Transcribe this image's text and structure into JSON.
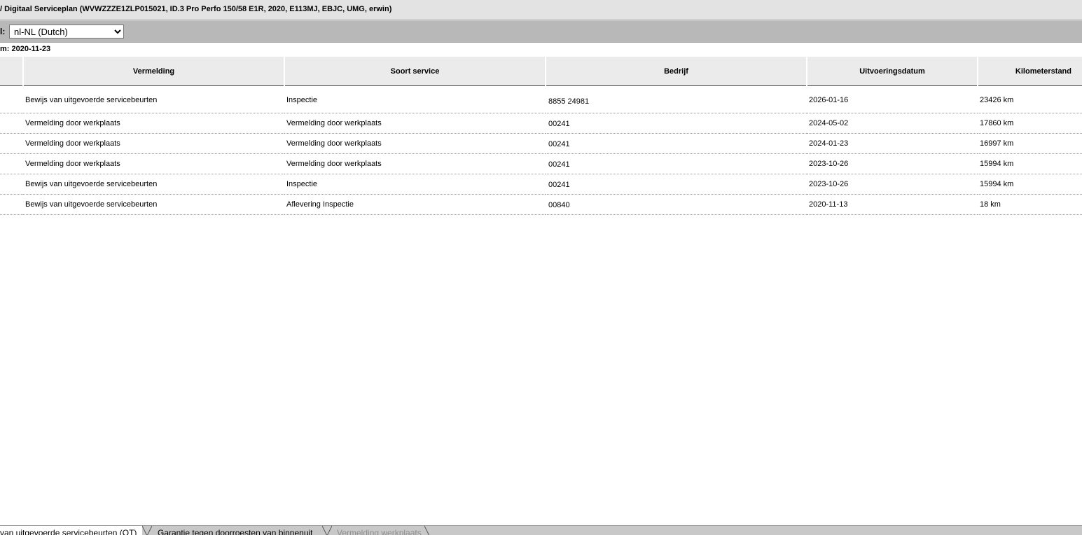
{
  "window": {
    "title": "/ Digitaal Serviceplan (WVWZZZE1ZLP015021, ID.3 Pro Perfo 150/58 E1R, 2020, E113MJ, EBJC, UMG, erwin)"
  },
  "language": {
    "label": "l:",
    "selected": "nl-NL (Dutch)"
  },
  "date_line": "m: 2020-11-23",
  "table": {
    "headers": {
      "col0": "",
      "vermelding": "Vermelding",
      "soort_service": "Soort service",
      "bedrijf": "Bedrijf",
      "uitvoeringsdatum": "Uitvoeringsdatum",
      "kilometerstand": "Kilometerstand"
    },
    "rows": [
      {
        "vermelding": "Bewijs van uitgevoerde servicebeurten",
        "soort_service": "Inspectie",
        "bedrijf": "8855 24981",
        "datum": "2026-01-16",
        "km": "23426 km"
      },
      {
        "vermelding": "Vermelding door werkplaats",
        "soort_service": "Vermelding door werkplaats",
        "bedrijf": "00241",
        "datum": "2024-05-02",
        "km": "17860 km"
      },
      {
        "vermelding": "Vermelding door werkplaats",
        "soort_service": "Vermelding door werkplaats",
        "bedrijf": "00241",
        "datum": "2024-01-23",
        "km": "16997 km"
      },
      {
        "vermelding": "Vermelding door werkplaats",
        "soort_service": "Vermelding door werkplaats",
        "bedrijf": "00241",
        "datum": "2023-10-26",
        "km": "15994 km"
      },
      {
        "vermelding": "Bewijs van uitgevoerde servicebeurten",
        "soort_service": "Inspectie",
        "bedrijf": "00241",
        "datum": "2023-10-26",
        "km": "15994 km"
      },
      {
        "vermelding": "Bewijs van uitgevoerde servicebeurten",
        "soort_service": "Aflevering Inspectie",
        "bedrijf": "00840",
        "datum": "2020-11-13",
        "km": "18 km"
      }
    ]
  },
  "tabs": [
    {
      "label": "van uitgevoerde servicebeurten (OT)",
      "state": "active"
    },
    {
      "label": "Garantie tegen doorroesten van binnenuit",
      "state": "normal"
    },
    {
      "label": "Vermelding werkplaats",
      "state": "disabled"
    }
  ],
  "colors": {
    "titlebar_bg": "#e3e3e3",
    "langbar_bg": "#b8b8b8",
    "header_bg": "#ebebeb",
    "tabbar_bg": "#c8c8c8"
  }
}
